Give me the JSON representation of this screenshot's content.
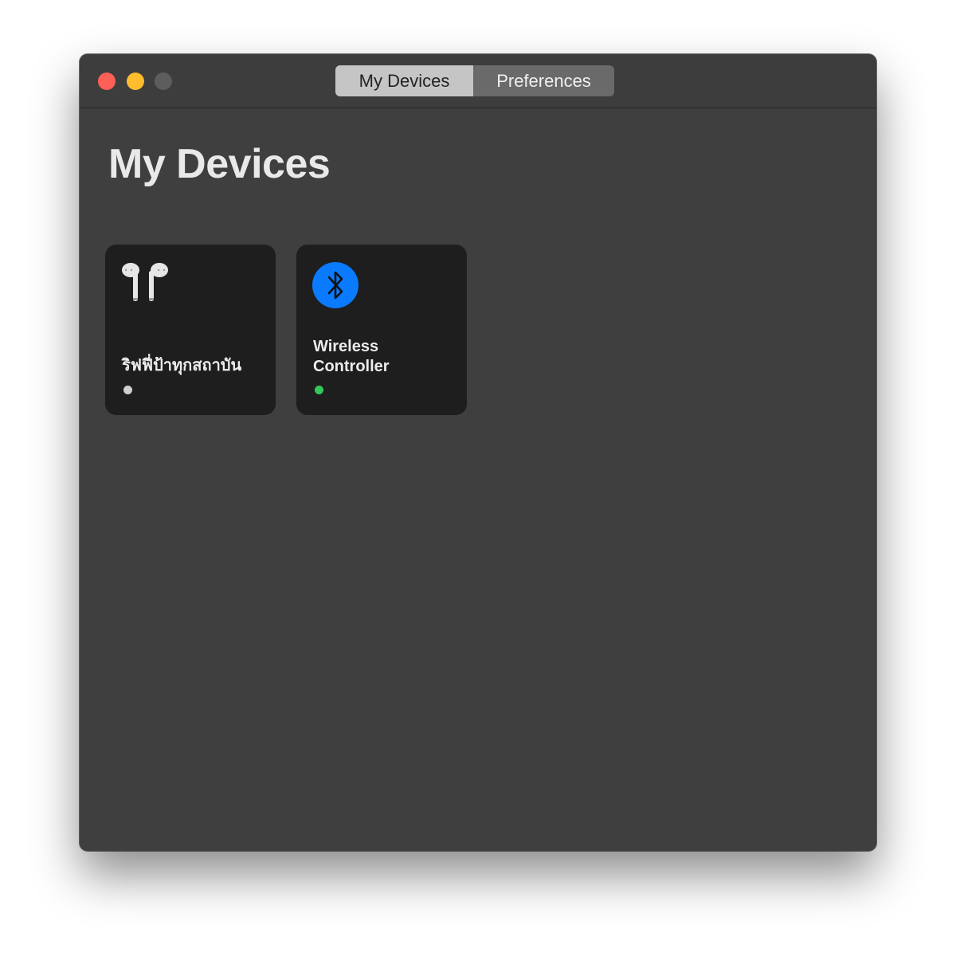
{
  "window": {
    "tabs": [
      {
        "label": "My Devices",
        "active": true
      },
      {
        "label": "Preferences",
        "active": false
      }
    ]
  },
  "main": {
    "title": "My Devices",
    "devices": [
      {
        "name": "ริฟฟี่ป้าทุกสถาบัน",
        "icon": "airpods-icon",
        "status": "disconnected",
        "status_color": "#d0d0d0"
      },
      {
        "name": "Wireless Controller",
        "icon": "bluetooth-icon",
        "status": "connected",
        "status_color": "#34c759"
      }
    ]
  },
  "colors": {
    "window_bg": "#3f3f3f",
    "card_bg": "#1e1e1e",
    "accent_blue": "#0a7aff",
    "close": "#fe5f57",
    "minimize": "#febc2e",
    "zoom_disabled": "#5d5d5d"
  }
}
